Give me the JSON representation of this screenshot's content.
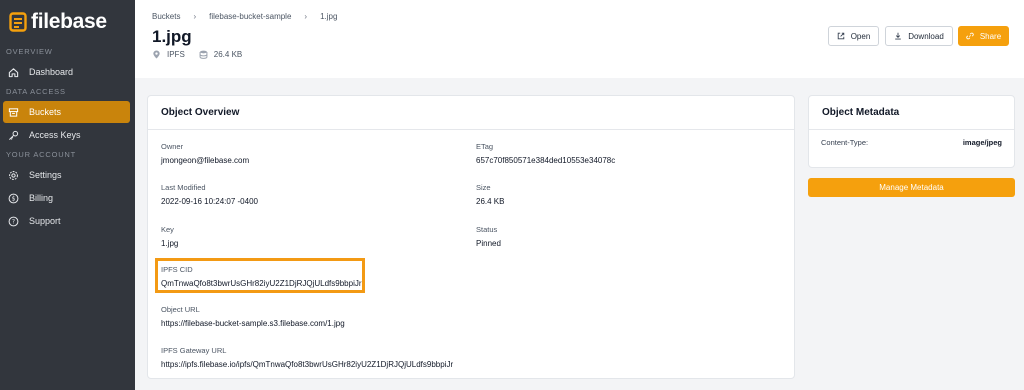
{
  "brand": {
    "name": "filebase"
  },
  "sidebar": {
    "sections": [
      {
        "label": "OVERVIEW"
      },
      {
        "label": "DATA ACCESS"
      },
      {
        "label": "YOUR ACCOUNT"
      }
    ],
    "items": [
      {
        "label": "Dashboard",
        "icon": "home-icon"
      },
      {
        "label": "Buckets",
        "icon": "bucket-icon",
        "active": true
      },
      {
        "label": "Access Keys",
        "icon": "key-icon"
      },
      {
        "label": "Settings",
        "icon": "gear-icon"
      },
      {
        "label": "Billing",
        "icon": "dollar-icon"
      },
      {
        "label": "Support",
        "icon": "help-icon"
      }
    ]
  },
  "header": {
    "breadcrumb": [
      "Buckets",
      "filebase-bucket-sample",
      "1.jpg"
    ],
    "title": "1.jpg",
    "storage_type": "IPFS",
    "size": "26.4 KB",
    "buttons": {
      "open": "Open",
      "download": "Download",
      "share": "Share"
    }
  },
  "overview": {
    "title": "Object Overview",
    "fields": [
      {
        "label": "Owner",
        "value": "jmongeon@filebase.com"
      },
      {
        "label": "ETag",
        "value": "657c70f850571e384ded10553e34078c"
      },
      {
        "label": "Last Modified",
        "value": "2022-09-16 10:24:07 -0400"
      },
      {
        "label": "Size",
        "value": "26.4 KB"
      },
      {
        "label": "Key",
        "value": "1.jpg"
      },
      {
        "label": "Status",
        "value": "Pinned"
      },
      {
        "label": "IPFS CID",
        "value": "QmTnwaQfo8t3bwrUsGHr82iyU2Z1DjRJQjULdfs9bbpiJr",
        "highlighted": true
      },
      {
        "label": "Object URL",
        "value": "https://filebase-bucket-sample.s3.filebase.com/1.jpg"
      },
      {
        "label": "IPFS Gateway URL",
        "value": "https://ipfs.filebase.io/ipfs/QmTnwaQfo8t3bwrUsGHr82iyU2Z1DjRJQjULdfs9bbpiJr"
      }
    ]
  },
  "metadata": {
    "title": "Object Metadata",
    "key": "Content-Type:",
    "value": "image/jpeg",
    "manage_label": "Manage Metadata"
  },
  "colors": {
    "accent": "#f5a00d",
    "sidebar_bg": "#32363d",
    "active_item": "#c9840c",
    "highlight_border": "#f39a14"
  }
}
